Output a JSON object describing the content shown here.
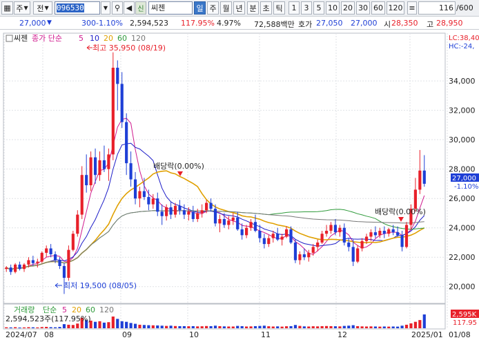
{
  "toolbar": {
    "market": "주",
    "type": "전",
    "code": "096530",
    "badge": "신",
    "name": "씨젠",
    "periods": [
      "일",
      "주",
      "월",
      "년",
      "분",
      "초",
      "틱"
    ],
    "active_period": "일",
    "intervals": [
      "1",
      "3",
      "5",
      "10",
      "20",
      "30",
      "60",
      "120"
    ],
    "count": "116",
    "total": "/600"
  },
  "quote": {
    "price": "27,000",
    "change": "300",
    "change_pct": "-1.10%",
    "volume": "2,594,523",
    "vol_ratio": "117.95%",
    "turnover": "4.97%",
    "amount": "72,588백만",
    "ask_label": "호가",
    "ask": "27,050",
    "bid": "27,000",
    "open_label": "시",
    "open": "28,350",
    "high_label": "고",
    "high": "28,950"
  },
  "legend": {
    "name": "씨젠",
    "series": "종가 단순",
    "ma": [
      "5",
      "10",
      "20",
      "60",
      "120"
    ],
    "lc": "LC:38,40",
    "hc": "HC:-24,"
  },
  "annotations": {
    "high": "최고 35,950 (08/19)",
    "low": "최저 19,500 (08/05)",
    "div1": "배당락(0.00%)",
    "div2": "배당락(0.00%)"
  },
  "volume_panel": {
    "label": "거래량",
    "series": "단순",
    "ma": [
      "5",
      "20",
      "60",
      "120"
    ],
    "value": "2,594,523주(117.95%)",
    "axis_top": "2,595K",
    "axis_pct": "117.95"
  },
  "price_tag": {
    "value": "27,000",
    "pct": "-1.10%"
  },
  "colors": {
    "up": "#e8202a",
    "down": "#1e3fd6",
    "ma5": "#d01a8e",
    "ma10": "#1c1cc8",
    "ma20": "#e0a000",
    "ma60": "#2e9a3a",
    "ma120": "#777777"
  },
  "chart_data": {
    "type": "candlestick",
    "y_ticks": [
      "34,000",
      "32,000",
      "30,000",
      "28,000",
      "26,000",
      "24,000",
      "22,000",
      "20,000"
    ],
    "ylim": [
      19000,
      36500
    ],
    "x_ticks": [
      "2024/07",
      "08",
      "09",
      "10",
      "11",
      "12",
      "2025/01",
      "01/08"
    ],
    "candles": [
      [
        21200,
        21400,
        21000,
        21300
      ],
      [
        21300,
        21500,
        20800,
        21000
      ],
      [
        21000,
        21600,
        20900,
        21500
      ],
      [
        21500,
        21700,
        21100,
        21200
      ],
      [
        21200,
        21600,
        21000,
        21500
      ],
      [
        21500,
        22000,
        21300,
        21800
      ],
      [
        21800,
        22100,
        21400,
        21600
      ],
      [
        21600,
        21900,
        21300,
        21700
      ],
      [
        21700,
        22400,
        21600,
        22300
      ],
      [
        22300,
        22800,
        22000,
        22600
      ],
      [
        22600,
        22900,
        22000,
        22200
      ],
      [
        22200,
        22400,
        21600,
        21800
      ],
      [
        21800,
        22000,
        21200,
        21400
      ],
      [
        21400,
        21600,
        19500,
        20600
      ],
      [
        20600,
        22800,
        20400,
        22500
      ],
      [
        22500,
        23800,
        22400,
        23600
      ],
      [
        23600,
        25200,
        23400,
        24900
      ],
      [
        24900,
        28200,
        24600,
        27600
      ],
      [
        27600,
        29000,
        26400,
        26900
      ],
      [
        26900,
        29200,
        26500,
        28800
      ],
      [
        28800,
        29400,
        27000,
        27600
      ],
      [
        27600,
        29200,
        27200,
        28600
      ],
      [
        28600,
        29600,
        27800,
        28000
      ],
      [
        28000,
        29400,
        27200,
        29000
      ],
      [
        29000,
        35950,
        28600,
        34900
      ],
      [
        34900,
        35400,
        32000,
        33800
      ],
      [
        33800,
        34600,
        30800,
        31200
      ],
      [
        31200,
        31800,
        27600,
        28400
      ],
      [
        28400,
        29200,
        26800,
        27300
      ],
      [
        27300,
        27800,
        25600,
        26000
      ],
      [
        26000,
        26800,
        25400,
        26500
      ],
      [
        26500,
        27400,
        25900,
        26100
      ],
      [
        26100,
        26600,
        25200,
        25600
      ],
      [
        25600,
        26300,
        25300,
        26000
      ],
      [
        26000,
        26400,
        24800,
        25100
      ],
      [
        25100,
        25600,
        24200,
        24800
      ],
      [
        24800,
        25600,
        24500,
        25400
      ],
      [
        25400,
        25800,
        24600,
        24900
      ],
      [
        24900,
        25700,
        24700,
        25500
      ],
      [
        25500,
        25900,
        24900,
        25200
      ],
      [
        25200,
        25600,
        24600,
        24900
      ],
      [
        24900,
        25400,
        24500,
        25100
      ],
      [
        25100,
        25500,
        24400,
        24600
      ],
      [
        24600,
        25300,
        24400,
        25000
      ],
      [
        25000,
        25600,
        24700,
        25200
      ],
      [
        25200,
        25900,
        25000,
        25700
      ],
      [
        25700,
        26000,
        25100,
        25300
      ],
      [
        25300,
        25600,
        24100,
        24300
      ],
      [
        24300,
        24900,
        23700,
        24600
      ],
      [
        24600,
        25000,
        24000,
        24200
      ],
      [
        24200,
        24800,
        23900,
        24500
      ],
      [
        24500,
        25000,
        24200,
        24700
      ],
      [
        24700,
        25100,
        23800,
        23900
      ],
      [
        23900,
        24300,
        23200,
        23500
      ],
      [
        23500,
        24200,
        23300,
        24000
      ],
      [
        24000,
        24600,
        23800,
        24400
      ],
      [
        24400,
        24900,
        23700,
        23800
      ],
      [
        23800,
        24200,
        23000,
        23300
      ],
      [
        23300,
        23600,
        22600,
        22900
      ],
      [
        22900,
        23500,
        22700,
        23300
      ],
      [
        23300,
        23800,
        23000,
        23600
      ],
      [
        23600,
        24000,
        23100,
        23200
      ],
      [
        23200,
        23600,
        22800,
        23400
      ],
      [
        23400,
        24100,
        23300,
        23900
      ],
      [
        23900,
        24100,
        22900,
        23000
      ],
      [
        23000,
        23200,
        21600,
        21800
      ],
      [
        21800,
        22400,
        21500,
        22200
      ],
      [
        22200,
        22600,
        21800,
        22000
      ],
      [
        22000,
        22500,
        21700,
        22300
      ],
      [
        22300,
        22900,
        22100,
        22700
      ],
      [
        22700,
        23200,
        22400,
        23000
      ],
      [
        23000,
        23800,
        22900,
        23600
      ],
      [
        23600,
        24200,
        23400,
        23800
      ],
      [
        23800,
        24400,
        23600,
        24200
      ],
      [
        24200,
        24600,
        23500,
        23700
      ],
      [
        23700,
        24200,
        23400,
        24000
      ],
      [
        24000,
        24300,
        22800,
        23000
      ],
      [
        23000,
        23300,
        22400,
        22700
      ],
      [
        22700,
        23200,
        21400,
        21700
      ],
      [
        21700,
        22800,
        21600,
        22600
      ],
      [
        22600,
        23300,
        22400,
        23100
      ],
      [
        23100,
        23600,
        22900,
        23400
      ],
      [
        23400,
        23900,
        23100,
        23700
      ],
      [
        23700,
        24100,
        23300,
        23500
      ],
      [
        23500,
        24000,
        23300,
        23800
      ],
      [
        23800,
        24100,
        23300,
        23600
      ],
      [
        23600,
        24000,
        23400,
        23900
      ],
      [
        23900,
        24200,
        23500,
        23700
      ],
      [
        23700,
        24100,
        23400,
        23500
      ],
      [
        23500,
        23800,
        22400,
        22700
      ],
      [
        22700,
        24400,
        22600,
        24200
      ],
      [
        24200,
        25600,
        23900,
        25300
      ],
      [
        25300,
        27400,
        25100,
        26600
      ],
      [
        26600,
        29300,
        26300,
        27900
      ],
      [
        27900,
        28950,
        26800,
        27000
      ]
    ],
    "volumes": [
      8,
      7,
      9,
      6,
      7,
      9,
      8,
      7,
      10,
      12,
      9,
      8,
      11,
      35,
      30,
      28,
      40,
      90,
      70,
      65,
      55,
      60,
      48,
      52,
      100,
      80,
      60,
      55,
      45,
      38,
      30,
      28,
      26,
      25,
      24,
      22,
      20,
      22,
      19,
      18,
      18,
      17,
      18,
      16,
      17,
      19,
      18,
      22,
      18,
      16,
      15,
      15,
      20,
      18,
      15,
      16,
      18,
      20,
      22,
      17,
      15,
      16,
      14,
      17,
      18,
      28,
      20,
      16,
      15,
      17,
      16,
      18,
      19,
      18,
      17,
      16,
      20,
      22,
      26,
      18,
      16,
      15,
      16,
      15,
      14,
      15,
      14,
      15,
      14,
      22,
      30,
      42,
      55,
      70,
      118
    ]
  }
}
